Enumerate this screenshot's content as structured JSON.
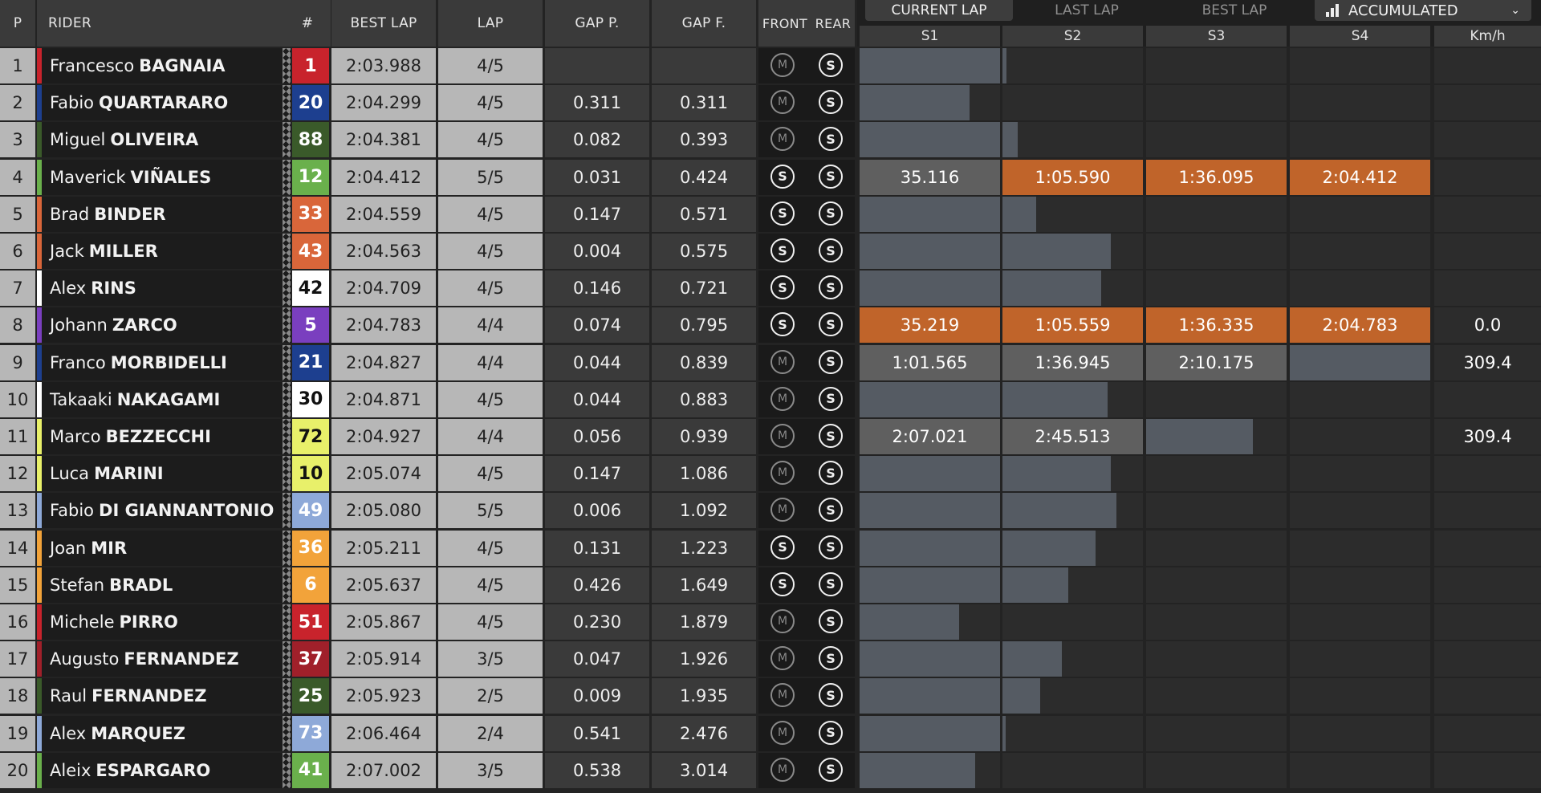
{
  "headers": {
    "pos": "P",
    "rider": "RIDER",
    "num": "#",
    "best_lap": "BEST LAP",
    "lap": "LAP",
    "gap_p": "GAP P.",
    "gap_f": "GAP F.",
    "front": "FRONT",
    "rear": "REAR"
  },
  "tabs": {
    "current": "CURRENT LAP",
    "last": "LAST LAP",
    "best": "BEST LAP"
  },
  "dropdown": {
    "label": "ACCUMULATED",
    "icon": "bar-chart-icon"
  },
  "sector_headers": [
    "S1",
    "S2",
    "S3",
    "S4",
    "Km/h"
  ],
  "colors": {
    "highlight_orange": "#c0642a",
    "progress_bar": "#555b63"
  },
  "riders": [
    {
      "pos": "1",
      "first": "Francesco",
      "last": "BAGNAIA",
      "num": "1",
      "color": "#c8232c",
      "best": "2:03.988",
      "lap": "4/5",
      "gap_p": "",
      "gap_f": "",
      "front": "M",
      "rear": "S",
      "mode": "progress",
      "progress": [
        1,
        0.03,
        0,
        0
      ],
      "kmh": ""
    },
    {
      "pos": "2",
      "first": "Fabio",
      "last": "QUARTARARO",
      "num": "20",
      "color": "#1d3f8f",
      "best": "2:04.299",
      "lap": "4/5",
      "gap_p": "0.311",
      "gap_f": "0.311",
      "front": "M",
      "rear": "S",
      "mode": "progress",
      "progress": [
        0.78,
        0,
        0,
        0
      ],
      "kmh": ""
    },
    {
      "pos": "3",
      "first": "Miguel",
      "last": "OLIVEIRA",
      "num": "88",
      "color": "#3a5a2a",
      "best": "2:04.381",
      "lap": "4/5",
      "gap_p": "0.082",
      "gap_f": "0.393",
      "front": "M",
      "rear": "S",
      "mode": "progress",
      "progress": [
        1,
        0.11,
        0,
        0
      ],
      "kmh": ""
    },
    {
      "pos": "4",
      "first": "Maverick",
      "last": "VIÑALES",
      "num": "12",
      "color": "#6ab04c",
      "best": "2:04.412",
      "lap": "5/5",
      "gap_p": "0.031",
      "gap_f": "0.424",
      "front": "S",
      "rear": "S",
      "mode": "times",
      "times": [
        "35.116",
        "1:05.590",
        "1:36.095",
        "2:04.412"
      ],
      "styles": [
        "grey",
        "orange",
        "orange",
        "orange"
      ],
      "kmh": ""
    },
    {
      "pos": "5",
      "first": "Brad",
      "last": "BINDER",
      "num": "33",
      "color": "#d9663a",
      "best": "2:04.559",
      "lap": "4/5",
      "gap_p": "0.147",
      "gap_f": "0.571",
      "front": "S",
      "rear": "S",
      "mode": "progress",
      "progress": [
        1,
        0.24,
        0,
        0
      ],
      "kmh": ""
    },
    {
      "pos": "6",
      "first": "Jack",
      "last": "MILLER",
      "num": "43",
      "color": "#d9663a",
      "best": "2:04.563",
      "lap": "4/5",
      "gap_p": "0.004",
      "gap_f": "0.575",
      "front": "S",
      "rear": "S",
      "mode": "progress",
      "progress": [
        1,
        0.77,
        0,
        0
      ],
      "kmh": ""
    },
    {
      "pos": "7",
      "first": "Alex",
      "last": "RINS",
      "num": "42",
      "color": "#ffffff",
      "best": "2:04.709",
      "lap": "4/5",
      "gap_p": "0.146",
      "gap_f": "0.721",
      "front": "S",
      "rear": "S",
      "mode": "progress",
      "progress": [
        1,
        0.7,
        0,
        0
      ],
      "kmh": ""
    },
    {
      "pos": "8",
      "first": "Johann",
      "last": "ZARCO",
      "num": "5",
      "color": "#7a3fbf",
      "best": "2:04.783",
      "lap": "4/4",
      "gap_p": "0.074",
      "gap_f": "0.795",
      "front": "S",
      "rear": "S",
      "mode": "times",
      "times": [
        "35.219",
        "1:05.559",
        "1:36.335",
        "2:04.783"
      ],
      "styles": [
        "orange",
        "orange",
        "orange",
        "orange"
      ],
      "kmh": "0.0"
    },
    {
      "pos": "9",
      "first": "Franco",
      "last": "MORBIDELLI",
      "num": "21",
      "color": "#1d3f8f",
      "best": "2:04.827",
      "lap": "4/4",
      "gap_p": "0.044",
      "gap_f": "0.839",
      "front": "M",
      "rear": "S",
      "mode": "times",
      "times": [
        "1:01.565",
        "1:36.945",
        "2:10.175",
        ""
      ],
      "styles": [
        "grey",
        "grey",
        "grey",
        "bar"
      ],
      "kmh": "309.4"
    },
    {
      "pos": "10",
      "first": "Takaaki",
      "last": "NAKAGAMI",
      "num": "30",
      "color": "#ffffff",
      "best": "2:04.871",
      "lap": "4/5",
      "gap_p": "0.044",
      "gap_f": "0.883",
      "front": "M",
      "rear": "S",
      "mode": "progress",
      "progress": [
        1,
        0.75,
        0,
        0
      ],
      "kmh": ""
    },
    {
      "pos": "11",
      "first": "Marco",
      "last": "BEZZECCHI",
      "num": "72",
      "color": "#e8f06a",
      "best": "2:04.927",
      "lap": "4/4",
      "gap_p": "0.056",
      "gap_f": "0.939",
      "front": "M",
      "rear": "S",
      "mode": "times",
      "times": [
        "2:07.021",
        "2:45.513",
        "",
        ""
      ],
      "styles": [
        "grey",
        "grey",
        "partial",
        "empty"
      ],
      "partial": 0.76,
      "kmh": "309.4"
    },
    {
      "pos": "12",
      "first": "Luca",
      "last": "MARINI",
      "num": "10",
      "color": "#e8f06a",
      "best": "2:05.074",
      "lap": "4/5",
      "gap_p": "0.147",
      "gap_f": "1.086",
      "front": "M",
      "rear": "S",
      "mode": "progress",
      "progress": [
        1,
        0.77,
        0,
        0
      ],
      "kmh": ""
    },
    {
      "pos": "13",
      "first": "Fabio",
      "last": "DI GIANNANTONIO",
      "num": "49",
      "color": "#8ea9d8",
      "best": "2:05.080",
      "lap": "5/5",
      "gap_p": "0.006",
      "gap_f": "1.092",
      "front": "M",
      "rear": "S",
      "mode": "progress",
      "progress": [
        1,
        0.81,
        0,
        0
      ],
      "kmh": ""
    },
    {
      "pos": "14",
      "first": "Joan",
      "last": "MIR",
      "num": "36",
      "color": "#f2a33a",
      "best": "2:05.211",
      "lap": "4/5",
      "gap_p": "0.131",
      "gap_f": "1.223",
      "front": "S",
      "rear": "S",
      "mode": "progress",
      "progress": [
        1,
        0.66,
        0,
        0
      ],
      "kmh": ""
    },
    {
      "pos": "15",
      "first": "Stefan",
      "last": "BRADL",
      "num": "6",
      "color": "#f2a33a",
      "best": "2:05.637",
      "lap": "4/5",
      "gap_p": "0.426",
      "gap_f": "1.649",
      "front": "S",
      "rear": "S",
      "mode": "progress",
      "progress": [
        1,
        0.47,
        0,
        0
      ],
      "kmh": ""
    },
    {
      "pos": "16",
      "first": "Michele",
      "last": "PIRRO",
      "num": "51",
      "color": "#c8232c",
      "best": "2:05.867",
      "lap": "4/5",
      "gap_p": "0.230",
      "gap_f": "1.879",
      "front": "M",
      "rear": "S",
      "mode": "progress",
      "progress": [
        0.71,
        0,
        0,
        0
      ],
      "kmh": ""
    },
    {
      "pos": "17",
      "first": "Augusto",
      "last": "FERNANDEZ",
      "num": "37",
      "color": "#a0202a",
      "best": "2:05.914",
      "lap": "3/5",
      "gap_p": "0.047",
      "gap_f": "1.926",
      "front": "M",
      "rear": "S",
      "mode": "progress",
      "progress": [
        1,
        0.42,
        0,
        0
      ],
      "kmh": ""
    },
    {
      "pos": "18",
      "first": "Raul",
      "last": "FERNANDEZ",
      "num": "25",
      "color": "#3a5a2a",
      "best": "2:05.923",
      "lap": "2/5",
      "gap_p": "0.009",
      "gap_f": "1.935",
      "front": "M",
      "rear": "S",
      "mode": "progress",
      "progress": [
        1,
        0.27,
        0,
        0
      ],
      "kmh": ""
    },
    {
      "pos": "19",
      "first": "Alex",
      "last": "MARQUEZ",
      "num": "73",
      "color": "#8ea9d8",
      "best": "2:06.464",
      "lap": "2/4",
      "gap_p": "0.541",
      "gap_f": "2.476",
      "front": "M",
      "rear": "S",
      "mode": "progress",
      "progress": [
        1,
        0.02,
        0,
        0
      ],
      "kmh": ""
    },
    {
      "pos": "20",
      "first": "Aleix",
      "last": "ESPARGARO",
      "num": "41",
      "color": "#6ab04c",
      "best": "2:07.002",
      "lap": "3/5",
      "gap_p": "0.538",
      "gap_f": "3.014",
      "front": "M",
      "rear": "S",
      "mode": "progress",
      "progress": [
        0.82,
        0,
        0,
        0
      ],
      "kmh": ""
    }
  ]
}
